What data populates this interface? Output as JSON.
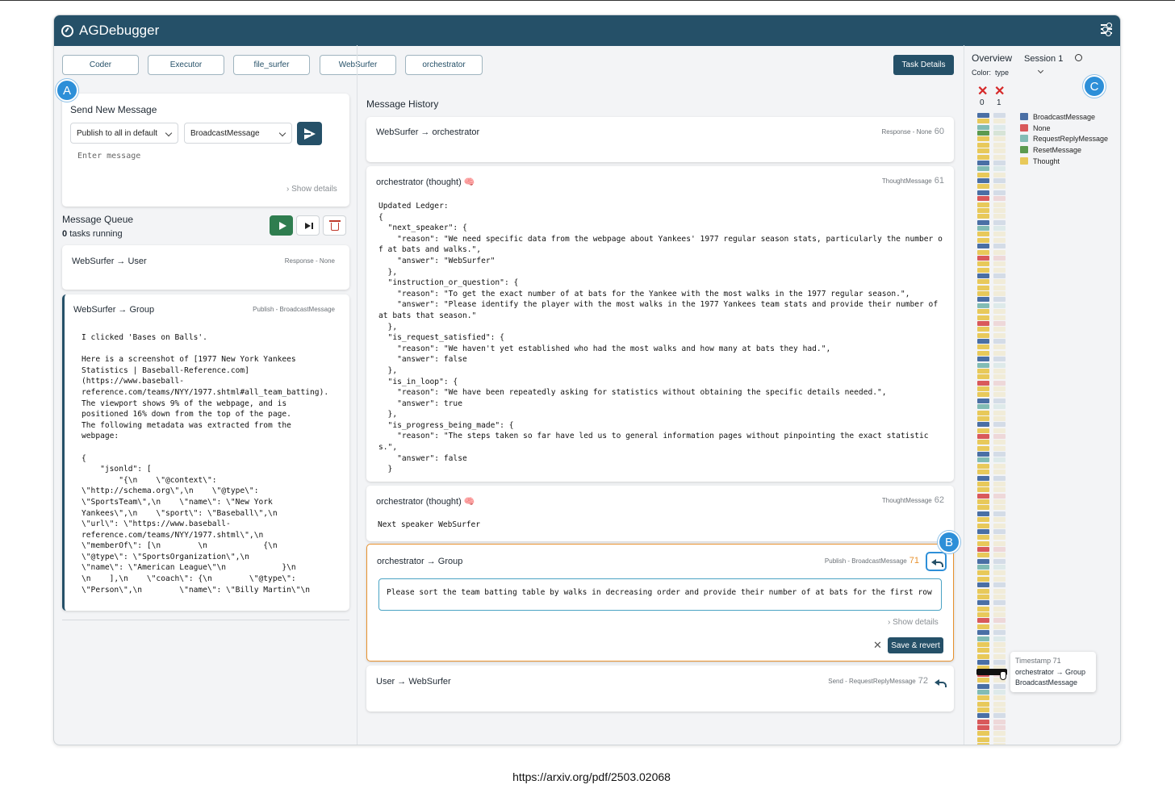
{
  "app": {
    "title": "AGDebugger"
  },
  "agents": [
    "Coder",
    "Executor",
    "file_surfer",
    "WebSurfer",
    "orchestrator"
  ],
  "task_details_label": "Task Details",
  "markers": {
    "a": "A",
    "b": "B",
    "c": "C"
  },
  "send": {
    "title": "Send New Message",
    "publish_select": "Publish to all in default",
    "type_select": "BroadcastMessage",
    "placeholder": "Enter message",
    "show_details": "Show details"
  },
  "queue": {
    "title": "Message Queue",
    "count_num": "0",
    "count_text": "tasks running",
    "items": [
      {
        "header": "WebSurfer → User",
        "meta": "Response - None",
        "body": ""
      },
      {
        "header": "WebSurfer → Group",
        "meta": "Publish - BroadcastMessage",
        "body": "I clicked 'Bases on Balls'.\n\nHere is a screenshot of [1977 New York Yankees\nStatistics | Baseball-Reference.com]\n(https://www.baseball-\nreference.com/teams/NYY/1977.shtml#all_team_batting).\nThe viewport shows 9% of the webpage, and is\npositioned 16% down from the top of the page.\nThe following metadata was extracted from the\nwebpage:\n\n{\n    \"jsonld\": [\n        \"{\\n    \\\"@context\\\":\n\\\"http://schema.org\\\",\\n    \\\"@type\\\":\n\\\"SportsTeam\\\",\\n    \\\"name\\\": \\\"New York\nYankees\\\",\\n    \\\"sport\\\": \\\"Baseball\\\",\\n\n\\\"url\\\": \\\"https://www.baseball-\nreference.com/teams/NYY/1977.shtml\\\",\\n\n\\\"memberOf\\\": [\\n        \\n            {\\n\n\\\"@type\\\": \\\"SportsOrganization\\\",\\n\n\\\"name\\\": \\\"American League\\\"\\n            }\\n\n\\n    ],\\n    \\\"coach\\\": {\\n        \\\"@type\\\":\n\\\"Person\\\",\\n        \\\"name\\\": \\\"Billy Martin\\\"\\n"
      }
    ]
  },
  "history": {
    "title": "Message History",
    "messages": [
      {
        "header": "WebSurfer → orchestrator",
        "meta": "Response - None",
        "num": "60",
        "body": ""
      },
      {
        "header": "orchestrator (thought) 🧠",
        "meta": "ThoughtMessage",
        "num": "61",
        "body": "Updated Ledger:\n{\n  \"next_speaker\": {\n    \"reason\": \"We need specific data from the webpage about Yankees' 1977 regular season stats, particularly the number o\nf at bats and walks.\",\n    \"answer\": \"WebSurfer\"\n  },\n  \"instruction_or_question\": {\n    \"reason\": \"To get the exact number of at bats for the Yankee with the most walks in the 1977 regular season.\",\n    \"answer\": \"Please identify the player with the most walks in the 1977 Yankees team stats and provide their number of\nat bats that season.\"\n  },\n  \"is_request_satisfied\": {\n    \"reason\": \"We haven't yet established who had the most walks and how many at bats they had.\",\n    \"answer\": false\n  },\n  \"is_in_loop\": {\n    \"reason\": \"We have been repeatedly asking for statistics without obtaining the specific details needed.\",\n    \"answer\": true\n  },\n  \"is_progress_being_made\": {\n    \"reason\": \"The steps taken so far have led us to general information pages without pinpointing the exact statistic\ns.\",\n    \"answer\": false\n  }"
      },
      {
        "header": "orchestrator (thought) 🧠",
        "meta": "ThoughtMessage",
        "num": "62",
        "body": "Next speaker WebSurfer"
      },
      {
        "header": "orchestrator → Group",
        "meta": "Publish - BroadcastMessage",
        "num": "71",
        "edit_text": "Please sort the team batting table by walks in decreasing order and provide their number of at bats for the first row",
        "show_details": "Show details",
        "save_label": "Save & revert",
        "cancel_label": "✕"
      },
      {
        "header": "User → WebSurfer",
        "meta": "Send - RequestReplyMessage",
        "num": "72",
        "body": ""
      }
    ]
  },
  "overview": {
    "title": "Overview",
    "session": "Session 1",
    "color_label": "Color:",
    "color_value": "type",
    "columns": [
      "0",
      "1"
    ],
    "legend": [
      {
        "label": "BroadcastMessage",
        "color": "#4a6fa5"
      },
      {
        "label": "None",
        "color": "#d9595b"
      },
      {
        "label": "RequestReplyMessage",
        "color": "#82bcb5"
      },
      {
        "label": "ResetMessage",
        "color": "#5b9a4f"
      },
      {
        "label": "Thought",
        "color": "#e8c95a"
      }
    ],
    "col0": [
      "B",
      "T",
      "R",
      "G",
      "T",
      "T",
      "T",
      "T",
      "B",
      "R",
      "T",
      "B",
      "T",
      "B",
      "N",
      "T",
      "T",
      "T",
      "B",
      "R",
      "T",
      "T",
      "B",
      "T",
      "N",
      "T",
      "T",
      "B",
      "T",
      "T",
      "T",
      "B",
      "R",
      "T",
      "T",
      "N",
      "T",
      "T",
      "B",
      "T",
      "T",
      "B",
      "R",
      "T",
      "T",
      "N",
      "T",
      "T",
      "B",
      "R",
      "T",
      "T",
      "B",
      "T",
      "N",
      "T",
      "T",
      "B",
      "R",
      "T",
      "T",
      "B",
      "T",
      "T",
      "N",
      "T",
      "T",
      "B",
      "T",
      "T",
      "B",
      "T",
      "T",
      "N",
      "T",
      "B",
      "R",
      "T",
      "T",
      "B",
      "T",
      "T",
      "B",
      "T",
      "T",
      "N",
      "T",
      "B",
      "R",
      "T",
      "T",
      "T",
      "B",
      "T",
      "N",
      "T",
      "B",
      "R",
      "T",
      "T",
      "T",
      "B",
      "N",
      "N",
      "T",
      "T",
      "T"
    ],
    "col1": [
      true,
      false,
      false,
      false,
      false,
      false,
      false,
      false,
      true,
      false,
      false,
      true,
      false,
      true,
      true,
      false,
      false,
      false,
      true,
      false,
      false,
      false,
      true,
      false,
      true,
      false,
      false,
      true,
      false,
      false,
      false,
      true,
      false,
      false,
      false,
      true,
      false,
      false,
      true,
      false,
      false,
      true,
      false,
      false,
      false,
      true,
      false,
      false,
      true,
      false,
      false,
      false,
      true,
      false,
      true,
      false,
      false,
      true,
      false,
      false,
      false,
      true,
      false,
      false,
      true,
      false,
      false,
      true,
      false,
      false,
      true,
      false,
      false,
      true,
      false,
      true,
      false,
      false,
      false,
      true,
      false,
      false,
      true,
      false,
      false,
      true,
      false,
      true,
      false,
      false,
      false,
      false,
      true,
      false,
      true,
      false,
      true,
      false,
      false,
      false,
      false,
      true,
      false,
      false,
      false,
      false,
      false
    ],
    "tooltip": {
      "line1": "Timestamp 71",
      "line2": "orchestrator → Group",
      "line3": "BroadcastMessage"
    }
  },
  "caption": "https://arxiv.org/pdf/2503.02068"
}
